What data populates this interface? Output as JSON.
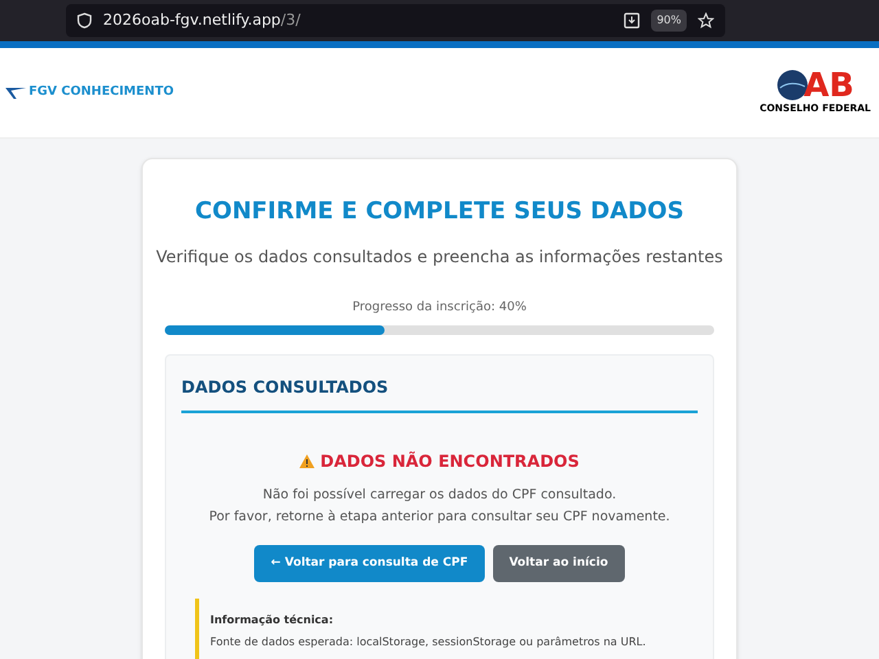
{
  "browser": {
    "url_host": "2026oab-fgv.netlify.app",
    "url_path": "/3/",
    "zoom": "90%"
  },
  "header": {
    "left_logo": "FGV CONHECIMENTO",
    "right_logo_letters": "AB",
    "right_logo_caption": "CONSELHO FEDERAL"
  },
  "card": {
    "title": "CONFIRME E COMPLETE SEUS DADOS",
    "subtitle": "Verifique os dados consultados e preencha as informações restantes",
    "progress": {
      "label": "Progresso da inscrição: 40%",
      "level": 0.4
    },
    "panel": {
      "heading": "DADOS CONSULTADOS",
      "error_title": "DADOS NÃO ENCONTRADOS",
      "message_lines": [
        "Não foi possível carregar os dados do CPF consultado.",
        "Por favor, retorne à etapa anterior para consultar seu CPF novamente."
      ],
      "buttons": [
        {
          "label": "← Voltar para consulta de CPF",
          "kind": "primary"
        },
        {
          "label": "Voltar ao início",
          "kind": "secondary"
        }
      ],
      "tech_info": {
        "title": "Informação técnica:",
        "text": "Fonte de dados esperada: localStorage, sessionStorage ou parâmetros na URL."
      }
    }
  }
}
